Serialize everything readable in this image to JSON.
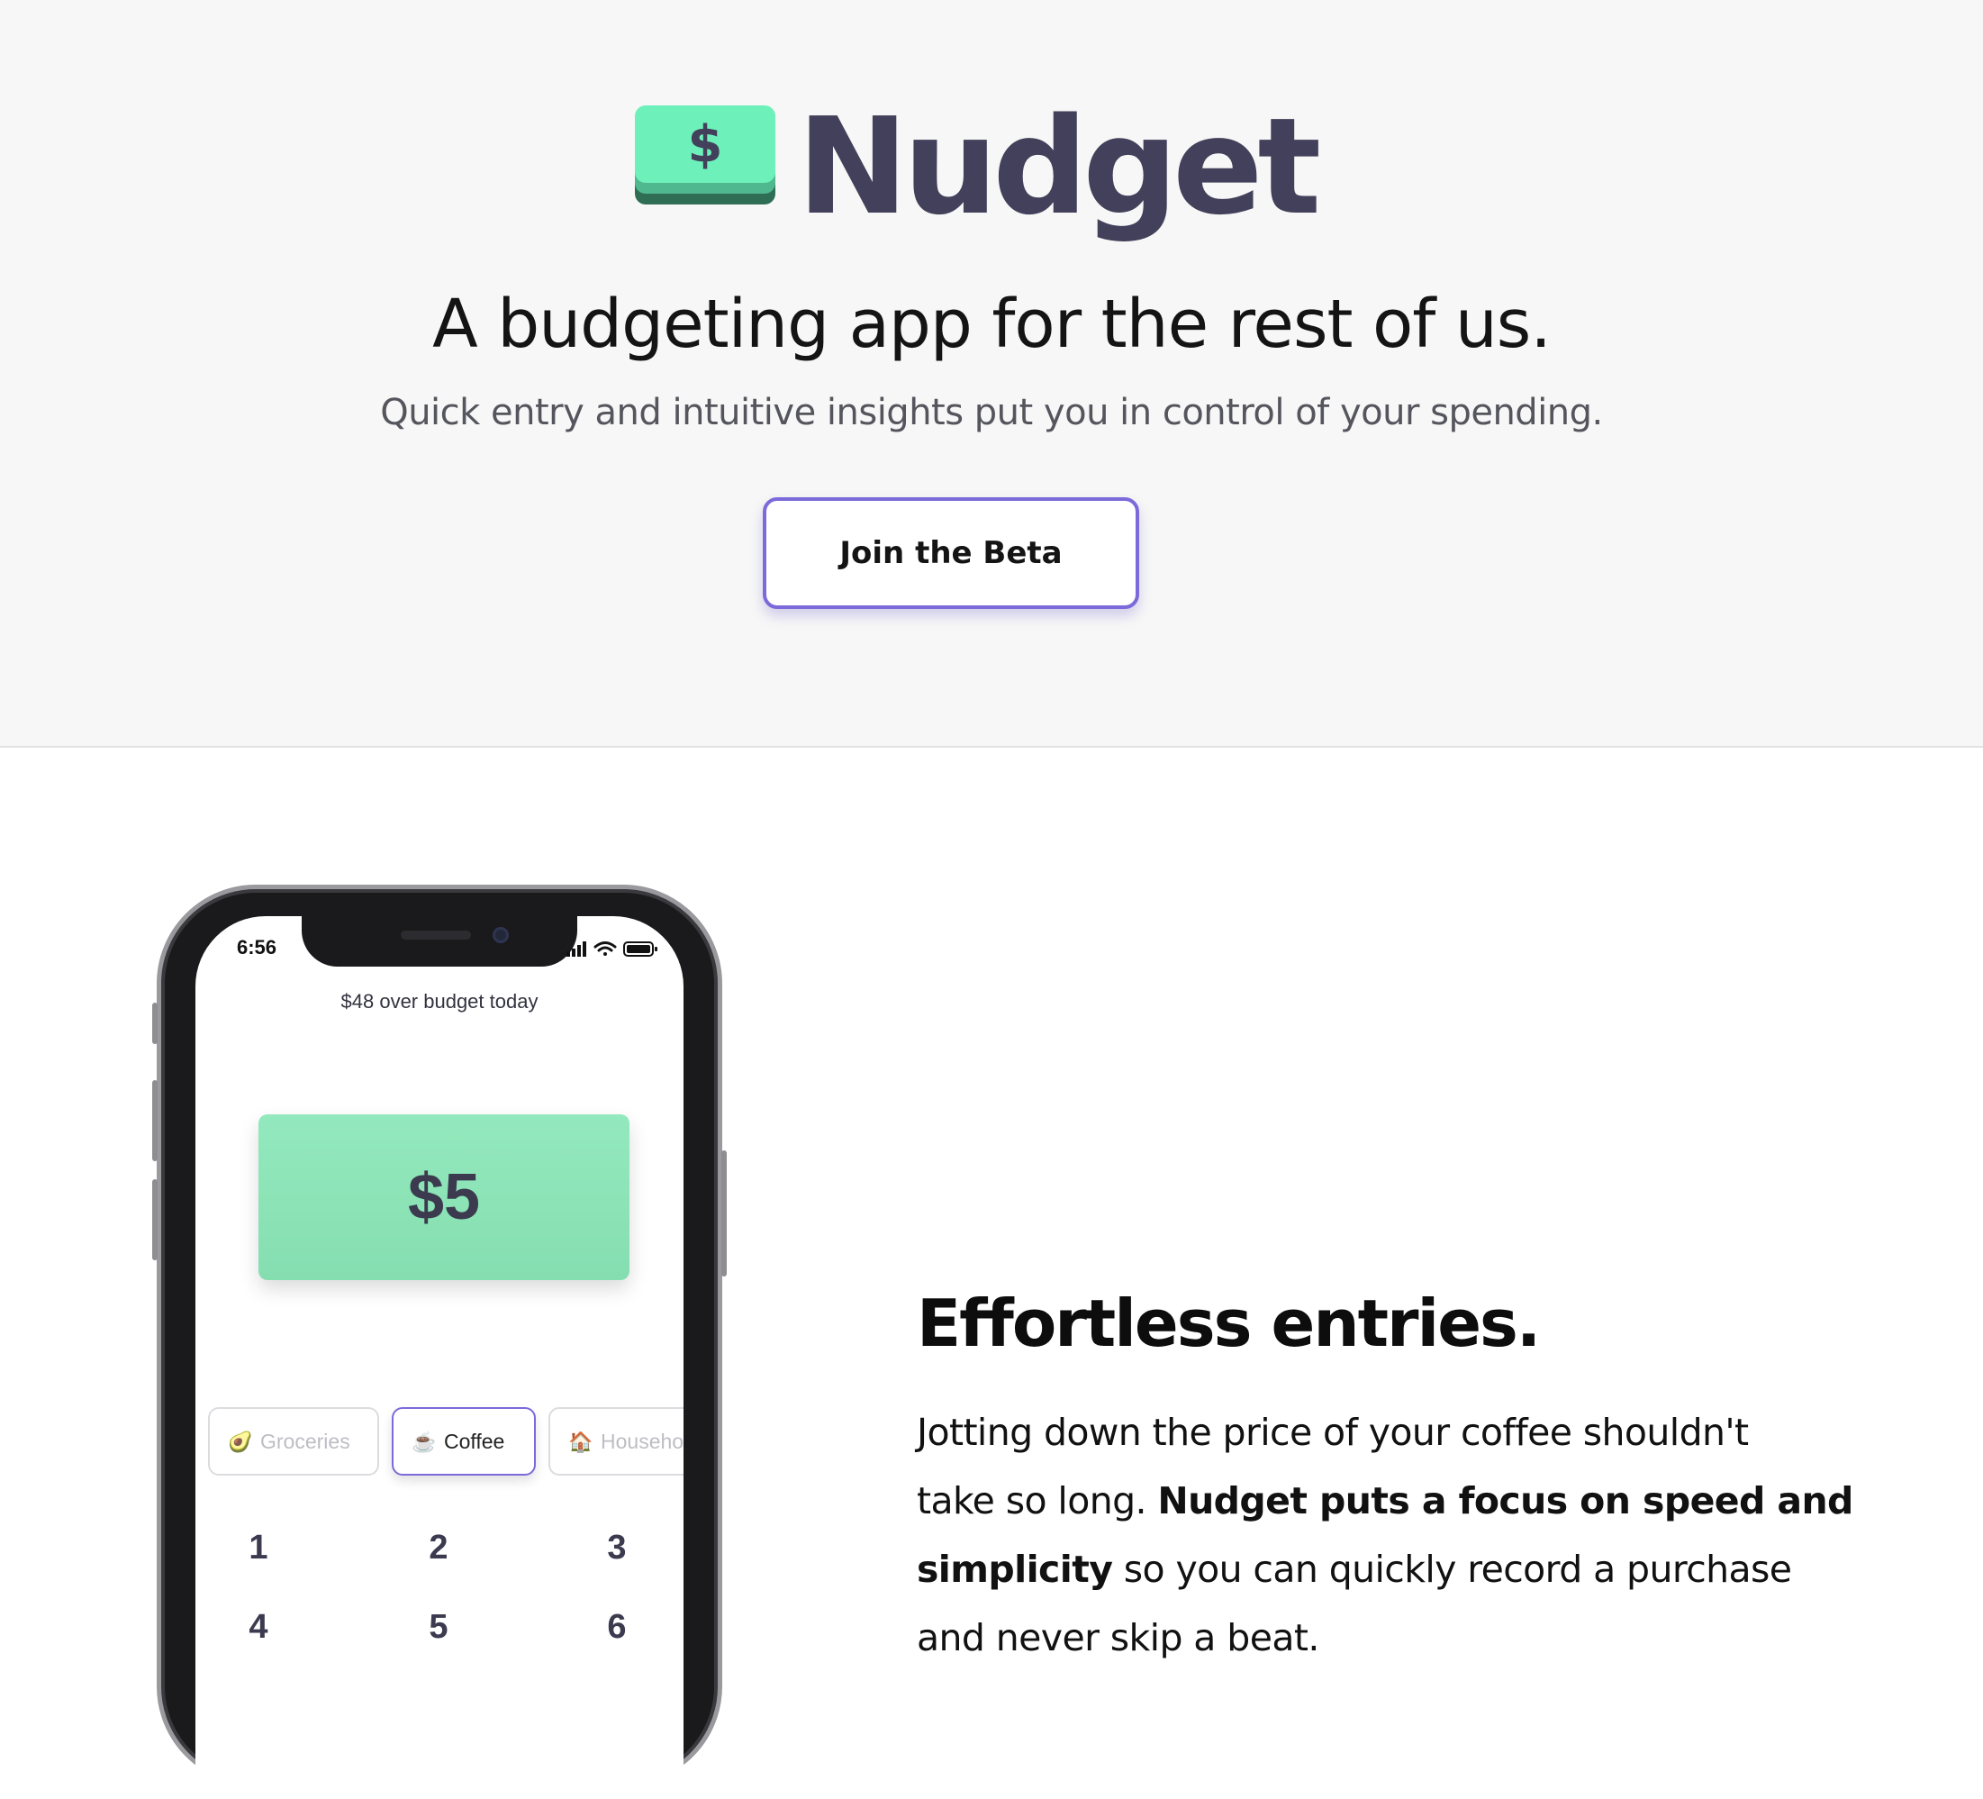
{
  "hero": {
    "brand": "Nudget",
    "logo_symbol": "$",
    "tagline": "A budgeting app for the rest of us.",
    "subtagline": "Quick entry and intuitive insights put you in control of your spending.",
    "cta_label": "Join the Beta"
  },
  "colors": {
    "brand_text": "#42405a",
    "logo_green": "#6ef0ba",
    "logo_green_mid": "#4fb88e",
    "logo_green_dark": "#2f6e55",
    "accent_purple": "#7b6ad9",
    "card_green": "#8de6b8"
  },
  "phone": {
    "status_time": "6:56",
    "status_icons": [
      "signal-icon",
      "wifi-icon",
      "battery-icon"
    ],
    "budget_status": "$48 over budget today",
    "amount": "$5",
    "categories": [
      {
        "emoji": "🥑",
        "label": "Groceries",
        "active": false
      },
      {
        "emoji": "☕",
        "label": "Coffee",
        "active": true
      },
      {
        "emoji": "🏠",
        "label": "Household",
        "active": false
      }
    ],
    "keypad": [
      "1",
      "2",
      "3",
      "4",
      "5",
      "6"
    ]
  },
  "feature": {
    "title": "Effortless entries.",
    "body_1": "Jotting down the price of your coffee shouldn't",
    "body_2a": "take so long. ",
    "body_2b": "Nudget puts a focus on speed and",
    "body_3a": "simplicity",
    "body_3b": " so you can quickly record a purchase",
    "body_4": "and never skip a beat."
  }
}
